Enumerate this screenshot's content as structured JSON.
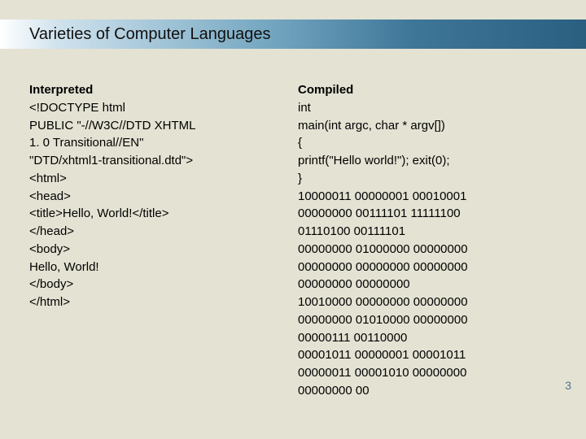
{
  "title": "Varieties of Computer Languages",
  "left": {
    "heading": "Interpreted",
    "body": "<!DOCTYPE html\nPUBLIC \"-//W3C//DTD XHTML\n1. 0 Transitional//EN\"\n\"DTD/xhtml1-transitional.dtd\">\n<html>\n<head>\n<title>Hello, World!</title>\n</head>\n<body>\nHello, World!\n</body>\n</html>"
  },
  "right": {
    "heading": "Compiled",
    "body": "int\nmain(int argc, char * argv[])\n{\nprintf(\"Hello world!\"); exit(0);\n}\n10000011 00000001 00010001\n00000000 00111101 11111100\n01110100 00111101\n00000000 01000000 00000000\n00000000 00000000 00000000\n00000000 00000000\n10010000 00000000 00000000\n00000000 01010000 00000000\n00000111 00110000\n00001011 00000001 00001011\n00000011 00001010 00000000\n00000000 00"
  },
  "page_number": "3"
}
